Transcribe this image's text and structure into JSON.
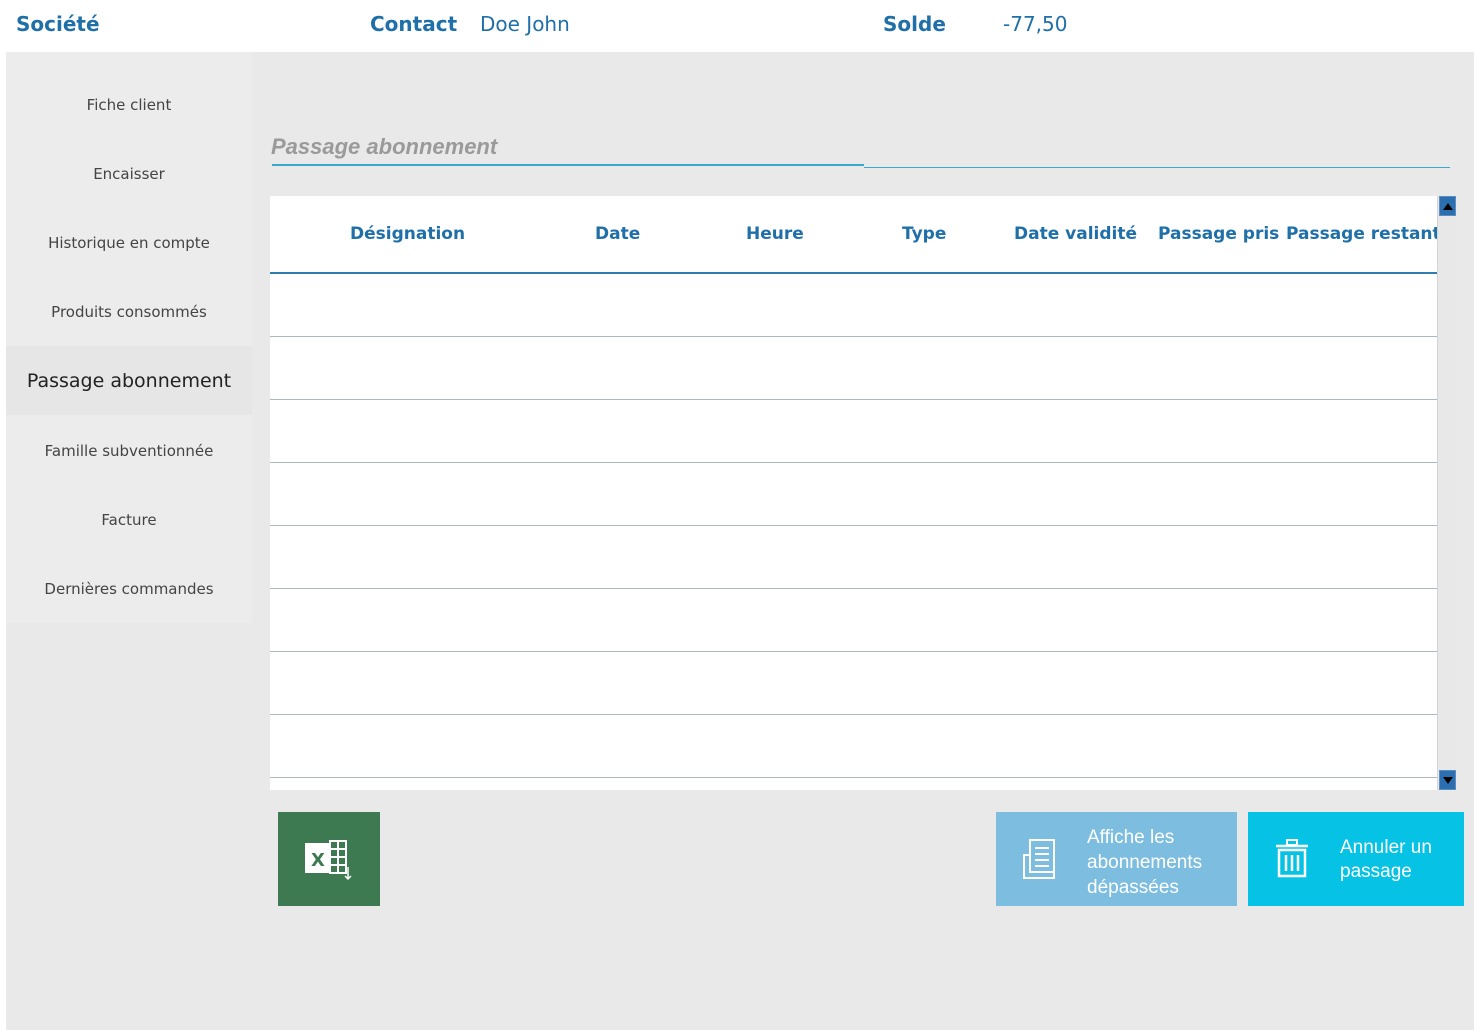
{
  "header": {
    "company_label": "Société",
    "contact_label": "Contact",
    "contact_name": "Doe John",
    "balance_label": "Solde",
    "balance_value": "-77,50"
  },
  "sidebar": {
    "items": [
      {
        "label": "Fiche client",
        "active": false
      },
      {
        "label": "Encaisser",
        "active": false
      },
      {
        "label": "Historique en compte",
        "active": false
      },
      {
        "label": "Produits consommés",
        "active": false
      },
      {
        "label": "Passage abonnement",
        "active": true
      },
      {
        "label": "Famille subventionnée",
        "active": false
      },
      {
        "label": "Facture",
        "active": false
      },
      {
        "label": "Dernières commandes",
        "active": false
      }
    ]
  },
  "main": {
    "section_title": "Passage abonnement",
    "table": {
      "columns": [
        "Désignation",
        "Date",
        "Heure",
        "Type",
        "Date validité",
        "Passage pris",
        "Passage restant"
      ],
      "rows": []
    },
    "actions": {
      "excel_icon": "excel-export-icon",
      "overdue_label": "Affiche les abonnements dépassées",
      "overdue_icon": "document-list-icon",
      "cancel_label": "Annuler un passage",
      "cancel_icon": "trash-icon"
    }
  },
  "colors": {
    "accent": "#1f6fa8",
    "excel_green": "#3d7a52",
    "overdue_blue": "#7dbde0",
    "cancel_cyan": "#06c2e5"
  }
}
